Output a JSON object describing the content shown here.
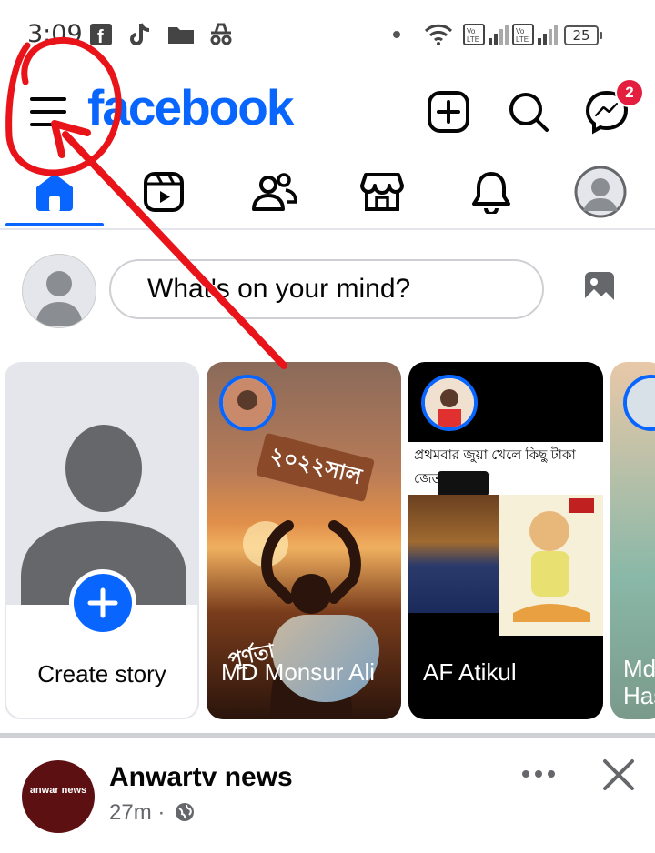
{
  "status_bar": {
    "time": "3:09",
    "battery": "25",
    "icons": [
      "facebook-icon",
      "tiktok-icon",
      "folder-icon",
      "incognito-icon",
      "dot-icon",
      "wifi-icon",
      "volte-icon",
      "signal-icon",
      "volte-icon",
      "signal-icon",
      "battery-icon"
    ]
  },
  "header": {
    "logo": "facebook",
    "messenger_badge": "2"
  },
  "tabs": [
    {
      "name": "home",
      "active": true
    },
    {
      "name": "video"
    },
    {
      "name": "friends"
    },
    {
      "name": "marketplace"
    },
    {
      "name": "notifications"
    },
    {
      "name": "profile"
    }
  ],
  "composer": {
    "placeholder": "What's on your mind?"
  },
  "stories": [
    {
      "label": "Create story"
    },
    {
      "label": "MD Monsur Ali",
      "overlay_text": "২০২২সাল",
      "overlay_text_2": "পূর্ণতা"
    },
    {
      "label": "AF Atikul",
      "overlay_text": "প্রথমবার জুয়া খেলে কিছু টাকা জেতার পর অ"
    },
    {
      "label": "Md Has"
    }
  ],
  "post": {
    "author": "Anwartv news",
    "time": "27m ·",
    "avatar_text": "anwar news"
  },
  "colors": {
    "brand": "#0866ff",
    "badge": "#e41e3f",
    "annotation": "#e8141a"
  }
}
